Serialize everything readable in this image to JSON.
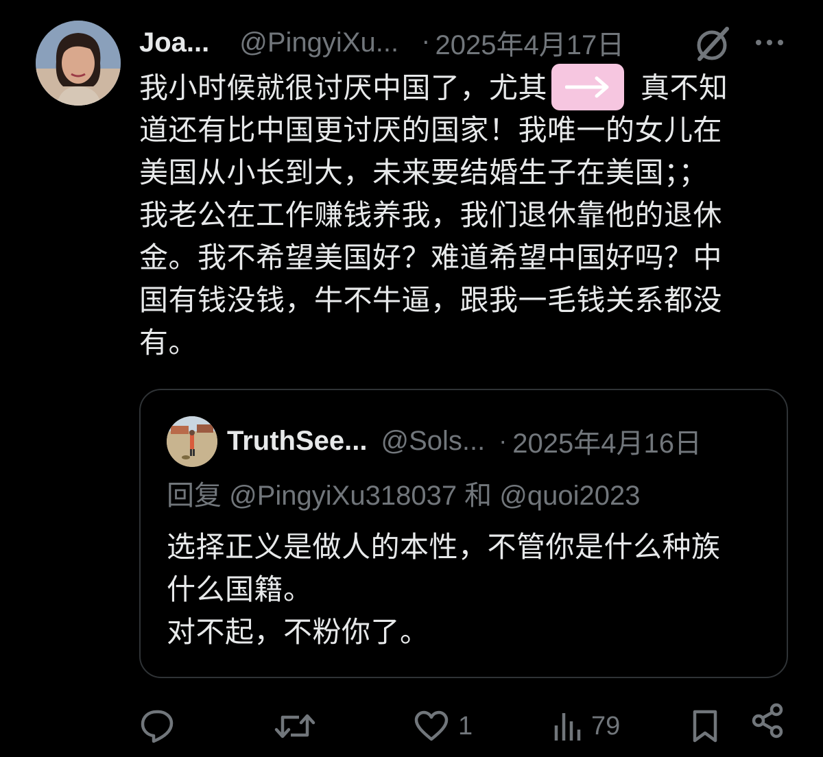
{
  "tweet": {
    "author": {
      "display_name": "Joa...",
      "handle": "@PingyiXu...",
      "separator": "·",
      "date": "2025年4月17日"
    },
    "icons": {
      "grok": "grok-icon",
      "more": "more-icon"
    },
    "body_lines": [
      {
        "before": "我小时候就很讨厌中国了，尤其",
        "after": "真不知"
      },
      "道还有比中国更讨厌的国家！我唯一的女儿在",
      "美国从小长到大，未来要结婚生子在美国；；",
      "我老公在工作赚钱养我，我们退休靠他的退休",
      "金。我不希望美国好？难道希望中国好吗？中",
      "国有钱没钱，牛不牛逼，跟我一毛钱关系都没",
      "有。"
    ],
    "overlay_badge": {
      "icon": "arrow-right-icon",
      "color": "#f6c6e0"
    }
  },
  "quote": {
    "author": {
      "display_name": "TruthSee...",
      "handle": "@Sols...",
      "separator": "·",
      "date": "2025年4月16日"
    },
    "reply_to": "回复 @PingyiXu318037 和 @quoi2023",
    "body_lines": [
      "选择正义是做人的本性，不管你是什么种族",
      "什么国籍。",
      "对不起，不粉你了。"
    ]
  },
  "actions": {
    "reply": {
      "icon": "reply-icon",
      "count": ""
    },
    "retweet": {
      "icon": "retweet-icon",
      "count": ""
    },
    "like": {
      "icon": "heart-icon",
      "count": "1"
    },
    "views": {
      "icon": "views-icon",
      "count": "79"
    },
    "bookmark": {
      "icon": "bookmark-icon"
    },
    "share": {
      "icon": "share-icon"
    }
  },
  "colors": {
    "background": "#000000",
    "text_primary": "#e7e9ea",
    "text_secondary": "#71767b",
    "border": "#2f3336"
  }
}
